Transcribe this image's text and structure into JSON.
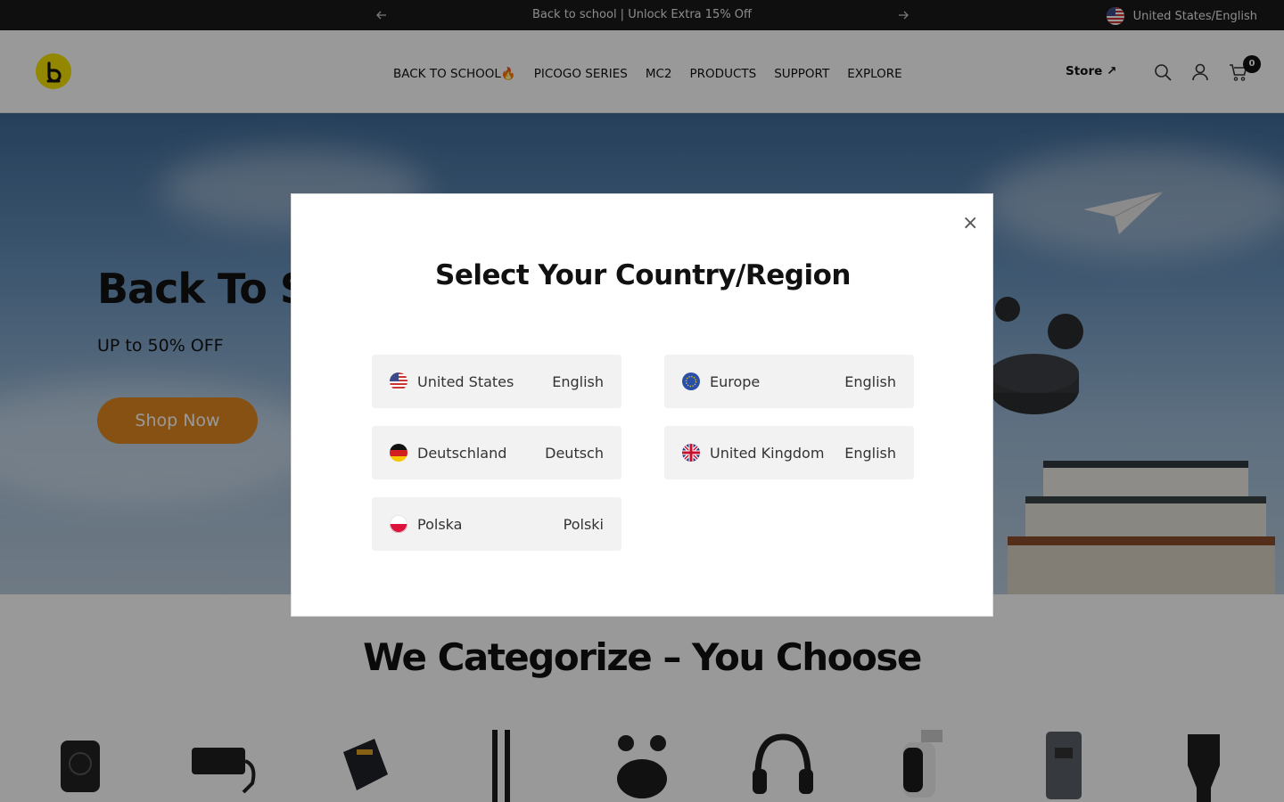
{
  "announcement": {
    "message": "Back to school | Unlock Extra 15% Off",
    "region_label": "United States/English",
    "prev_icon": "arrow-left-icon",
    "next_icon": "arrow-right-icon"
  },
  "header": {
    "nav": [
      "BACK TO SCHOOL🔥",
      "PICOGO SERIES",
      "MC2",
      "PRODUCTS",
      "SUPPORT",
      "EXPLORE"
    ],
    "store_label": "Store ↗",
    "cart_count": "0",
    "icons": [
      "search-icon",
      "account-icon",
      "cart-icon"
    ]
  },
  "hero": {
    "title": "Back To Scl",
    "subtitle": "UP to 50% OFF",
    "cta": "Shop Now"
  },
  "categories": {
    "title": "We Categorize – You Choose",
    "items": [
      "power-bank",
      "charging-station",
      "charger",
      "cable",
      "earbuds",
      "headphones",
      "camera",
      "adapter",
      "car-charger"
    ]
  },
  "modal": {
    "title": "Select Your Country/Region",
    "close_label": "×",
    "regions": [
      {
        "country": "United States",
        "language": "English",
        "flag": "us-flag-icon"
      },
      {
        "country": "Europe",
        "language": "English",
        "flag": "eu-flag-icon"
      },
      {
        "country": "Deutschland",
        "language": "Deutsch",
        "flag": "de-flag-icon"
      },
      {
        "country": "United Kingdom",
        "language": "English",
        "flag": "uk-flag-icon"
      },
      {
        "country": "Polska",
        "language": "Polski",
        "flag": "pl-flag-icon"
      }
    ]
  },
  "colors": {
    "announcement_bg": "#1a1a1a",
    "cta": "#e08720",
    "logo": "#f5e100"
  }
}
